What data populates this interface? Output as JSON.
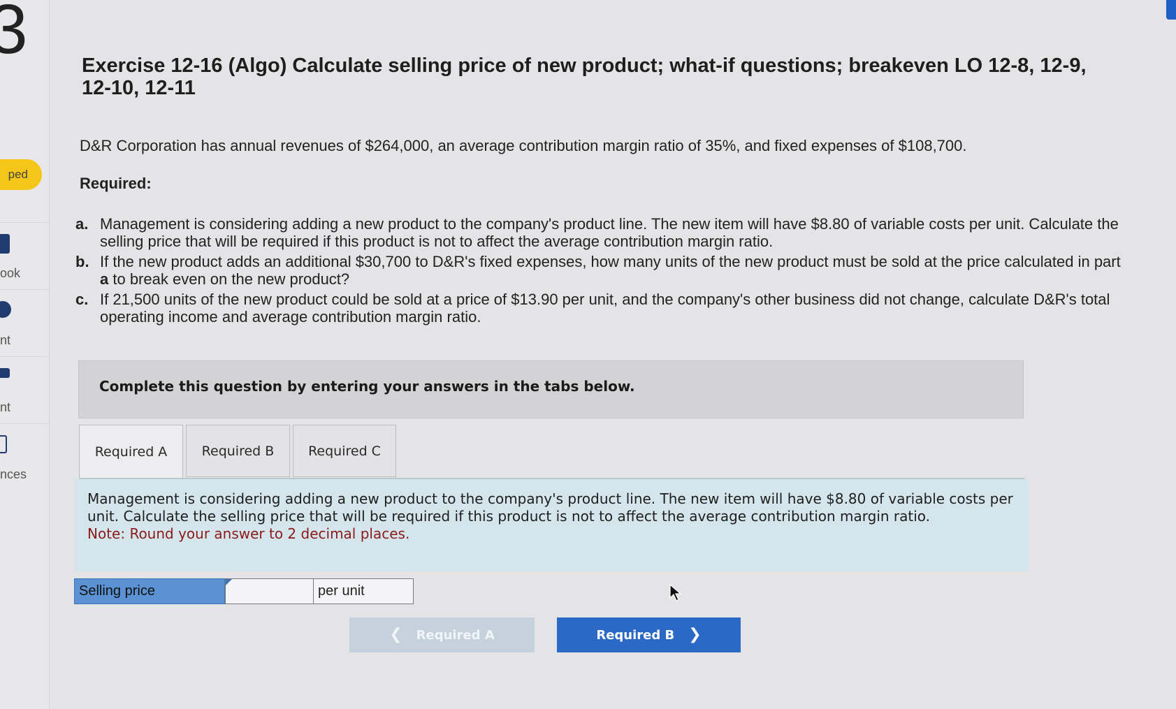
{
  "sidebar": {
    "number": "3",
    "badge": "ped",
    "items": [
      {
        "label": "ook",
        "icon": "book-icon"
      },
      {
        "label": "nt",
        "icon": "print-icon"
      },
      {
        "label": "nt",
        "icon": "print-icon"
      },
      {
        "label": "nces",
        "icon": "references-icon"
      }
    ]
  },
  "header": {
    "title": "Exercise 12-16 (Algo) Calculate selling price of new product; what-if questions; breakeven LO 12-8, 12-9, 12-10, 12-11"
  },
  "problem": {
    "intro": "D&R Corporation has annual revenues of $264,000, an average contribution margin ratio of 35%, and fixed expenses of $108,700.",
    "required_heading": "Required:",
    "requirements": [
      {
        "marker": "a.",
        "text": "Management is considering adding a new product to the company's product line. The new item will have $8.80 of variable costs per unit. Calculate the selling price that will be required if this product is not to affect the average contribution margin ratio."
      },
      {
        "marker": "b.",
        "text_before": "If the new product adds an additional $30,700 to D&R's fixed expenses, how many units of the new product must be sold at the price calculated in part ",
        "bold": "a",
        "text_after": " to break even on the new product?"
      },
      {
        "marker": "c.",
        "text": "If 21,500 units of the new product could be sold at a price of $13.90 per unit, and the company's other business did not change, calculate D&R's total operating income and average contribution margin ratio."
      }
    ]
  },
  "instruction": "Complete this question by entering your answers in the tabs below.",
  "tabs": [
    {
      "label": "Required A",
      "active": true
    },
    {
      "label": "Required B",
      "active": false
    },
    {
      "label": "Required C",
      "active": false
    }
  ],
  "panel": {
    "text": "Management is considering adding a new product to the company's product line. The new item will have $8.80 of variable costs per unit. Calculate the selling price that will be required if this product is not to affect the average contribution margin ratio.",
    "note": "Note: Round your answer to 2 decimal places."
  },
  "answer": {
    "label": "Selling price",
    "value": "",
    "unit": "per unit"
  },
  "navigation": {
    "prev_label": "Required A",
    "next_label": "Required B"
  },
  "colors": {
    "accent": "#2a6ac6",
    "label_blue": "#5a92d3",
    "panel_bg": "#d4e5ec",
    "note_red": "#8b1a1a",
    "badge_yellow": "#f5c518"
  }
}
